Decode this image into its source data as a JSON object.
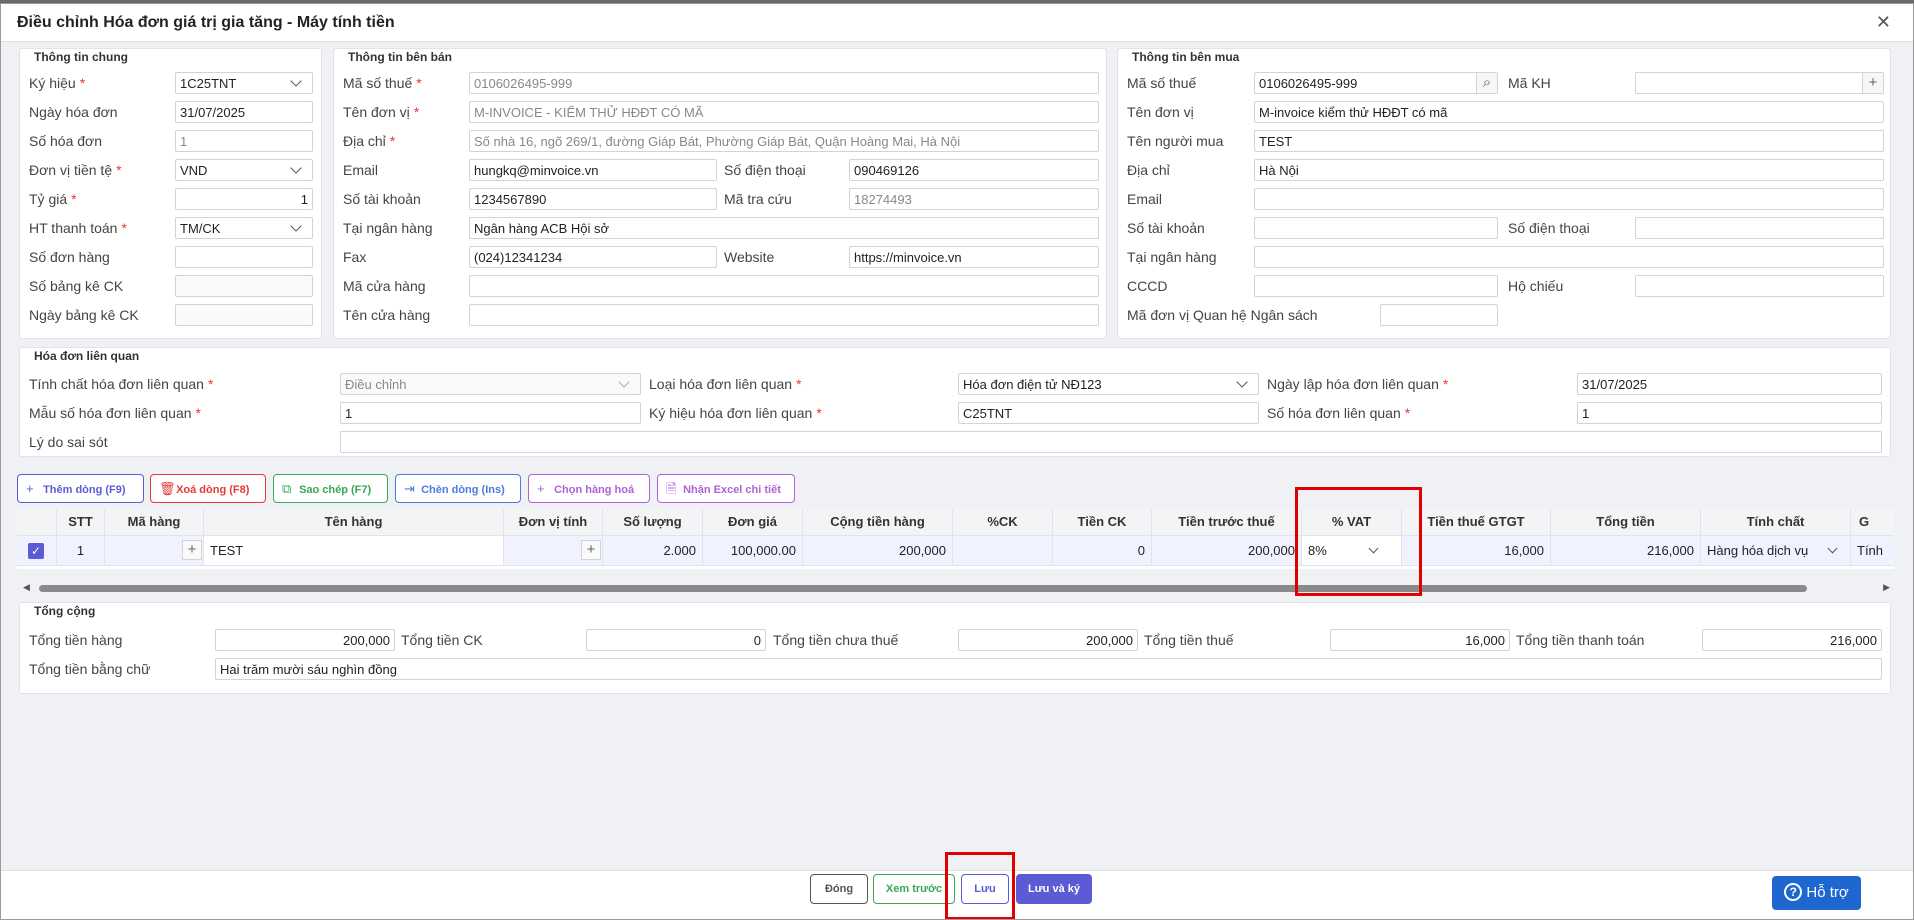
{
  "modal": {
    "title": "Điều chỉnh Hóa đơn giá trị gia tăng - Máy tính tiền"
  },
  "general": {
    "title": "Thông tin chung",
    "fields": {
      "ky_hieu": {
        "label": "Ký hiệu",
        "value": "1C25TNT"
      },
      "ngay_hoa_don": {
        "label": "Ngày hóa đơn",
        "value": "31/07/2025"
      },
      "so_hoa_don": {
        "label": "Số hóa đơn",
        "value": "1"
      },
      "don_vi_tien_te": {
        "label": "Đơn vị tiền tệ",
        "value": "VND"
      },
      "ty_gia": {
        "label": "Tỷ giá",
        "value": "1"
      },
      "ht_thanh_toan": {
        "label": "HT thanh toán",
        "value": "TM/CK"
      },
      "so_don_hang": {
        "label": "Số đơn hàng",
        "value": ""
      },
      "so_bang_ke": {
        "label": "Số bảng kê CK",
        "value": ""
      },
      "ngay_bang_ke": {
        "label": "Ngày bảng kê CK",
        "value": ""
      }
    }
  },
  "seller": {
    "title": "Thông tin bên bán",
    "fields": {
      "ma_so_thue": {
        "label": "Mã số thuế",
        "value": "0106026495-999"
      },
      "ten_don_vi": {
        "label": "Tên đơn vị",
        "value": "M-INVOICE - KIỂM THỬ HĐĐT CÓ MÃ"
      },
      "dia_chi": {
        "label": "Địa chỉ",
        "value": "Số nhà 16, ngõ 269/1, đường Giáp Bát, Phường Giáp Bát, Quận Hoàng Mai, Hà Nội"
      },
      "email": {
        "label": "Email",
        "value": "hungkq@minvoice.vn"
      },
      "so_dien_thoai": {
        "label": "Số điện thoại",
        "value": "090469126"
      },
      "so_tai_khoan": {
        "label": "Số tài khoản",
        "value": "1234567890"
      },
      "ma_tra_cuu": {
        "label": "Mã tra cứu",
        "value": "18274493"
      },
      "tai_ngan_hang": {
        "label": "Tại ngân hàng",
        "value": "Ngân hàng ACB Hội sở"
      },
      "fax": {
        "label": "Fax",
        "value": "(024)12341234"
      },
      "website": {
        "label": "Website",
        "value": "https://minvoice.vn"
      },
      "ma_cua_hang": {
        "label": "Mã cửa hàng",
        "value": ""
      },
      "ten_cua_hang": {
        "label": "Tên cửa hàng",
        "value": ""
      }
    }
  },
  "buyer": {
    "title": "Thông tin bên mua",
    "fields": {
      "ma_so_thue": {
        "label": "Mã số thuế",
        "value": "0106026495-999"
      },
      "ma_kh": {
        "label": "Mã KH",
        "value": ""
      },
      "ten_don_vi": {
        "label": "Tên đơn vị",
        "value": "M-invoice kiểm thử HĐĐT có mã"
      },
      "ten_nguoi_mua": {
        "label": "Tên người mua",
        "value": "TEST"
      },
      "dia_chi": {
        "label": "Địa chỉ",
        "value": "Hà Nội"
      },
      "email": {
        "label": "Email",
        "value": ""
      },
      "so_tai_khoan": {
        "label": "Số tài khoản",
        "value": ""
      },
      "so_dien_thoai": {
        "label": "Số điện thoại",
        "value": ""
      },
      "tai_ngan_hang": {
        "label": "Tại ngân hàng",
        "value": ""
      },
      "cccd": {
        "label": "CCCD",
        "value": ""
      },
      "ho_chieu": {
        "label": "Hộ chiếu",
        "value": ""
      },
      "ma_qhns": {
        "label": "Mã đơn vị Quan hệ Ngân sách",
        "value": ""
      }
    }
  },
  "related": {
    "title": "Hóa đơn liên quan",
    "fields": {
      "tinh_chat": {
        "label": "Tính chất hóa đơn liên quan",
        "value": "Điều chỉnh"
      },
      "loai": {
        "label": "Loại hóa đơn liên quan",
        "value": "Hóa đơn điện tử NĐ123"
      },
      "ngay_lap": {
        "label": "Ngày lập hóa đơn liên quan",
        "value": "31/07/2025"
      },
      "mau_so": {
        "label": "Mẫu số hóa đơn liên quan",
        "value": "1"
      },
      "ky_hieu": {
        "label": "Ký hiệu hóa đơn liên quan",
        "value": "C25TNT"
      },
      "so_hd": {
        "label": "Số hóa đơn liên quan",
        "value": "1"
      },
      "ly_do": {
        "label": "Lý do sai sót",
        "value": ""
      }
    }
  },
  "toolbar": {
    "add": "Thêm dòng (F9)",
    "delete": "Xoá dòng (F8)",
    "copy": "Sao chép (F7)",
    "insert": "Chèn dòng (Ins)",
    "choose": "Chọn hàng hoá",
    "excel": "Nhận Excel chi tiết"
  },
  "grid": {
    "columns": [
      "STT",
      "Mã hàng",
      "Tên hàng",
      "Đơn vị tính",
      "Số lượng",
      "Đơn giá",
      "Cộng tiền hàng",
      "%CK",
      "Tiền CK",
      "Tiền trước thuế",
      "% VAT",
      "Tiền thuế GTGT",
      "Tổng tiền",
      "Tính chất",
      "G"
    ],
    "rows": [
      {
        "stt": "1",
        "ma_hang": "",
        "ten_hang": "TEST",
        "dvt": "",
        "so_luong": "2.000",
        "don_gia": "100,000.00",
        "cong_tien_hang": "200,000",
        "ck_percent": "",
        "tien_ck": "0",
        "tien_truoc_thue": "200,000",
        "vat": "8%",
        "tien_thue": "16,000",
        "tong_tien": "216,000",
        "tinh_chat": "Hàng hóa dịch vụ",
        "extra": "Tính"
      }
    ]
  },
  "totals": {
    "title": "Tổng cộng",
    "tong_tien_hang": {
      "label": "Tổng tiền hàng",
      "value": "200,000"
    },
    "tong_tien_ck": {
      "label": "Tổng tiền CK",
      "value": "0"
    },
    "tong_chua_thue": {
      "label": "Tổng tiền chưa thuế",
      "value": "200,000"
    },
    "tong_thue": {
      "label": "Tổng tiền thuế",
      "value": "16,000"
    },
    "tong_thanh_toan": {
      "label": "Tổng tiền thanh toán",
      "value": "216,000"
    },
    "bang_chu": {
      "label": "Tổng tiền bằng chữ",
      "value": "Hai trăm mười sáu nghìn đồng"
    }
  },
  "footer": {
    "close": "Đóng",
    "preview": "Xem trước",
    "save": "Lưu",
    "save_sign": "Lưu và ký"
  },
  "support": {
    "label": "Hỗ trợ"
  },
  "colors": {
    "primary": "#5b5bd6",
    "danger": "#e53935",
    "success": "#3aa757",
    "purple": "#b061d6",
    "blue": "#4a7be0",
    "highlight": "#e10000"
  }
}
